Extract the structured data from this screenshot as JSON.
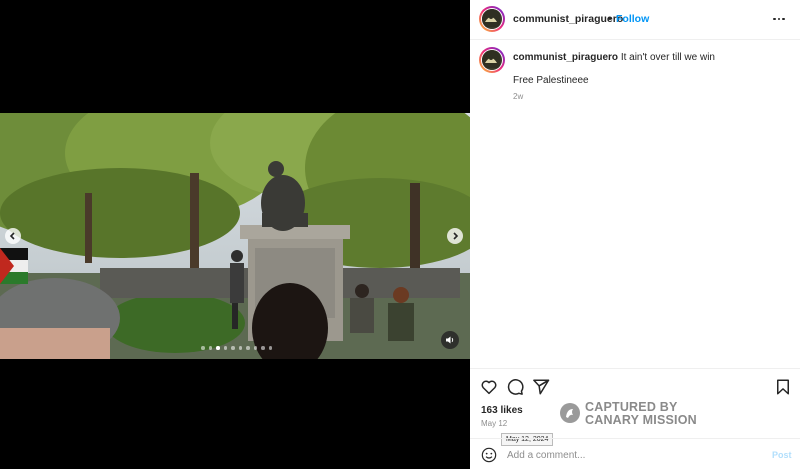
{
  "header": {
    "username": "communist_piraguero",
    "separator": "•",
    "follow_label": "Follow",
    "more_icon": "more-horizontal-icon"
  },
  "caption": {
    "username": "communist_piraguero",
    "text": "It ain't over till we win",
    "extra": "Free Palestineee",
    "time": "2w"
  },
  "media": {
    "carousel_dots": 10,
    "active_dot": 2,
    "prev_icon": "chevron-left-icon",
    "next_icon": "chevron-right-icon",
    "audio_icon": "volume-icon"
  },
  "actions": {
    "like_icon": "heart-icon",
    "comment_icon": "comment-icon",
    "share_icon": "paper-plane-icon",
    "save_icon": "bookmark-icon"
  },
  "likes": "163 likes",
  "date": "May 12",
  "date_tooltip": "May 12, 2024",
  "comment": {
    "placeholder": "Add a comment...",
    "post_label": "Post"
  },
  "watermark": {
    "line1": "CAPTURED BY",
    "line2": "CANARY MISSION"
  },
  "colors": {
    "link_blue": "#0095f6",
    "post_disabled": "#b2dffc",
    "muted_text": "#8e8e8e"
  }
}
